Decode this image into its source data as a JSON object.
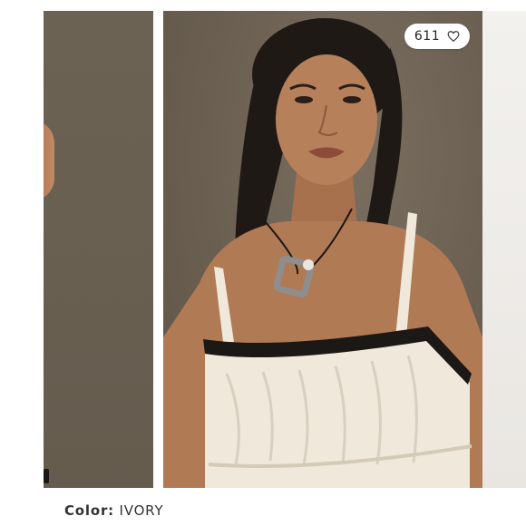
{
  "listing": {
    "like_count": "611",
    "heart_icon": "heart-outline-icon",
    "color_label": "Color:",
    "color_value": "IVORY"
  },
  "colors": {
    "backdrop": "#6a5f51",
    "garment_ivory": "#efe8db",
    "garment_trim": "#1c1815",
    "skin": "#b07a55",
    "hair": "#1e1915"
  }
}
